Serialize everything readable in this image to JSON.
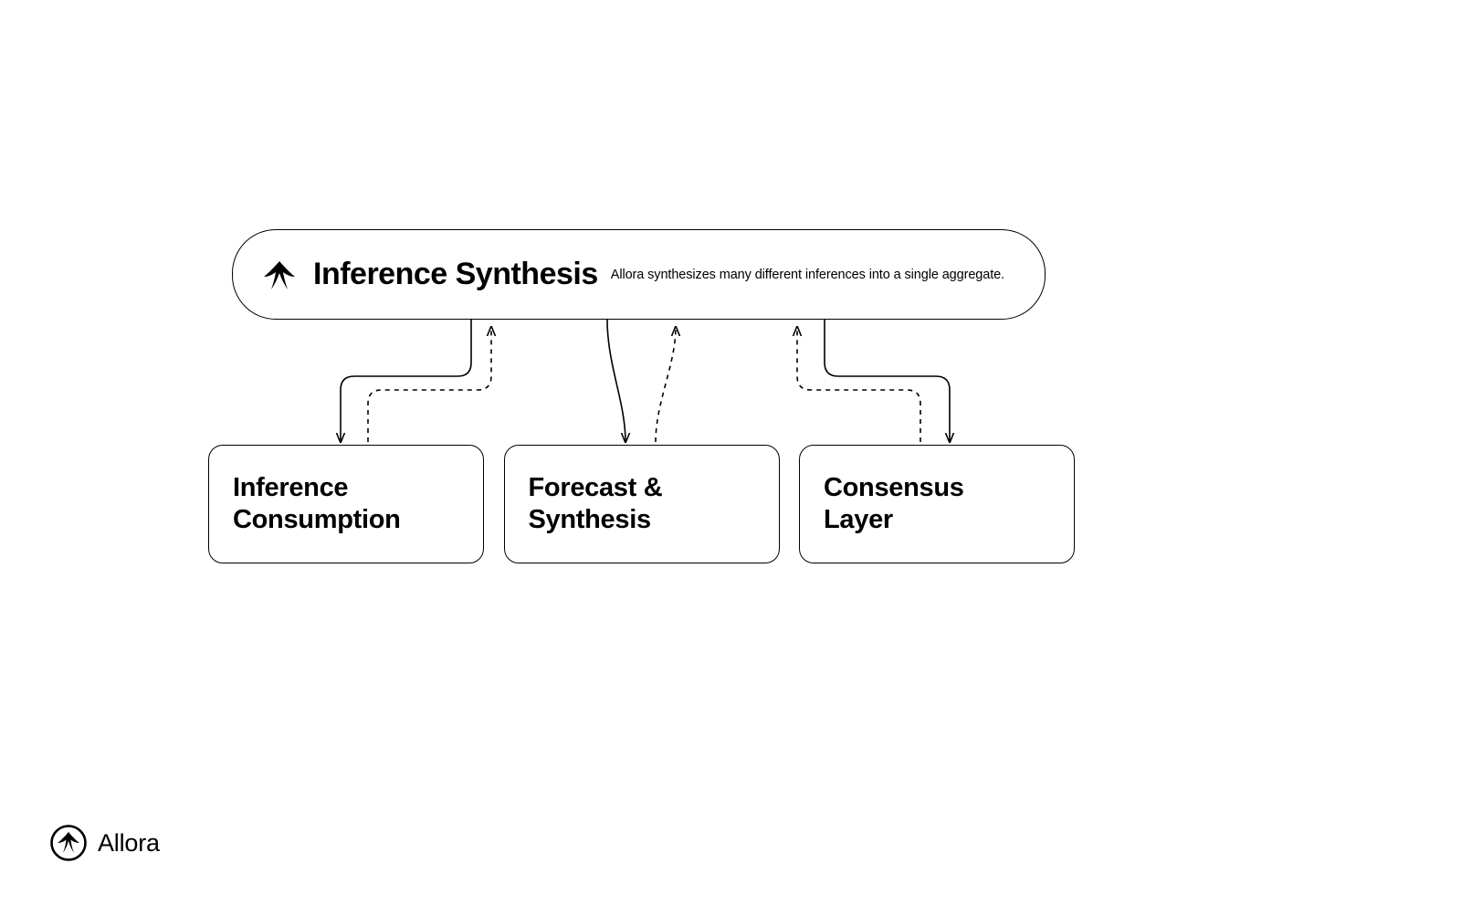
{
  "top": {
    "title": "Inference Synthesis",
    "subtitle": "Allora synthesizes many different inferences into a single aggregate."
  },
  "cards": [
    {
      "label": "Inference\nConsumption"
    },
    {
      "label": "Forecast &\nSynthesis"
    },
    {
      "label": "Consensus\nLayer"
    }
  ],
  "brand": {
    "name": "Allora"
  }
}
